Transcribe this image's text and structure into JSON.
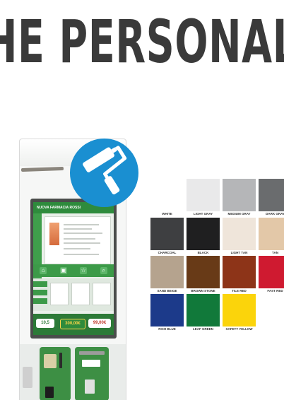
{
  "headline": "HE PERSONAL",
  "kiosk_screen": {
    "store_name": "NUOVA FARMACIA ROSSI",
    "prices": [
      "10,5",
      "300,00€",
      "99,00€"
    ]
  },
  "brush_icon": {
    "name": "paint-roller-icon",
    "color": "#1a8fd1"
  },
  "color_options": [
    {
      "name": "WHITE",
      "hex": "#ffffff"
    },
    {
      "name": "LIGHT GRAY",
      "hex": "#e9e9ea"
    },
    {
      "name": "MEDIUM GRAY",
      "hex": "#b5b6b8"
    },
    {
      "name": "DARK GRAY",
      "hex": "#6a6c6e"
    },
    {
      "name": "CHARCOAL",
      "hex": "#3e3f41"
    },
    {
      "name": "BLACK",
      "hex": "#1f1f20"
    },
    {
      "name": "LIGHT TAN",
      "hex": "#efe5da"
    },
    {
      "name": "TAN",
      "hex": "#e3c8a8"
    },
    {
      "name": "SAND BEIGE",
      "hex": "#b5a38e"
    },
    {
      "name": "BROWN STONE",
      "hex": "#683a17"
    },
    {
      "name": "TILE RED",
      "hex": "#8d3418"
    },
    {
      "name": "FAST RED",
      "hex": "#cf1a30"
    },
    {
      "name": "RICH BLUE",
      "hex": "#1c3a8a"
    },
    {
      "name": "LEAF GREEN",
      "hex": "#11793a"
    },
    {
      "name": "SAFETY YELLOW",
      "hex": "#fbd40b"
    }
  ]
}
